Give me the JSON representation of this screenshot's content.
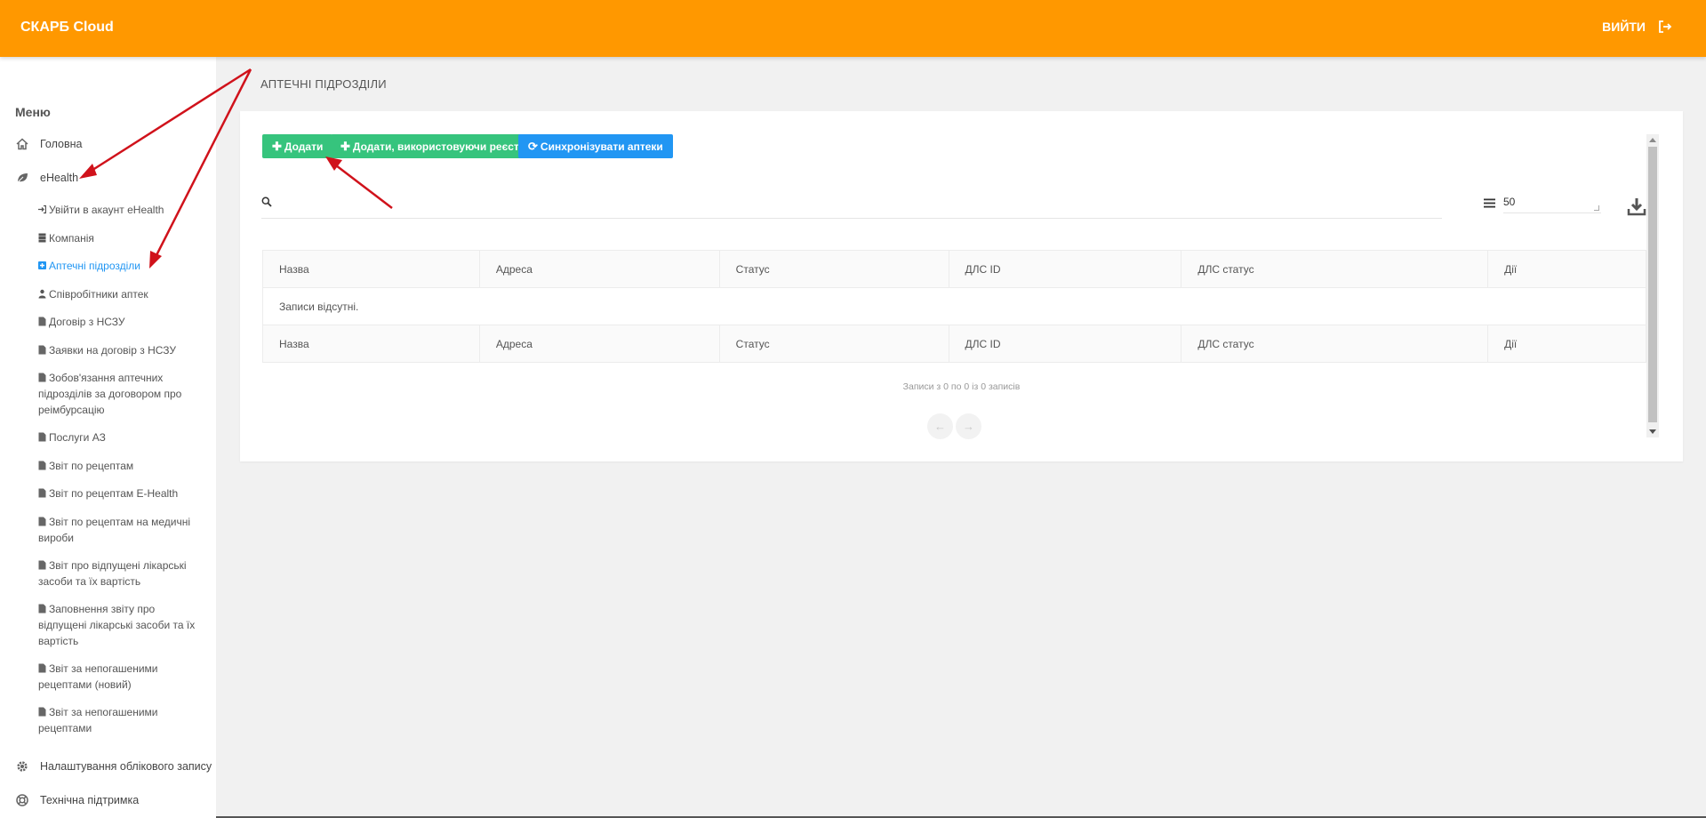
{
  "header": {
    "brand": "СКАРБ Cloud",
    "logout_label": "ВИЙТИ"
  },
  "sidebar": {
    "menu_title": "Меню",
    "home_label": "Головна",
    "ehealth_label": "eHealth",
    "items": [
      {
        "label": "Увійти в акаунт eHealth",
        "icon": "sign-in-icon"
      },
      {
        "label": "Компанія",
        "icon": "database-icon"
      },
      {
        "label": "Аптечні підрозділи",
        "icon": "plus-square-icon",
        "active": true
      },
      {
        "label": "Співробітники аптек",
        "icon": "users-icon"
      },
      {
        "label": "Договір з НСЗУ",
        "icon": "file-icon"
      },
      {
        "label": "Заявки на договір з НСЗУ",
        "icon": "file-icon"
      },
      {
        "label": "Зобов'язання аптечних підрозділів за договором про реімбурсацію",
        "icon": "file-icon"
      },
      {
        "label": "Послуги АЗ",
        "icon": "file-icon"
      },
      {
        "label": "Звіт по рецептам",
        "icon": "file-icon"
      },
      {
        "label": "Звіт по рецептам E-Health",
        "icon": "file-icon"
      },
      {
        "label": "Звіт по рецептам на медичні вироби",
        "icon": "file-icon"
      },
      {
        "label": "Звіт про відпущені лікарські засоби та їх вартість",
        "icon": "file-icon"
      },
      {
        "label": "Заповнення звіту про відпущені лікарські засоби та їх вартість",
        "icon": "file-icon"
      },
      {
        "label": "Звіт за непогашеними рецептами (новий)",
        "icon": "file-icon"
      },
      {
        "label": "Звіт за непогашеними рецептами",
        "icon": "file-icon"
      }
    ],
    "settings_label": "Налаштування облікового запису",
    "support_label": "Технічна підтримка"
  },
  "page": {
    "title": "АПТЕЧНІ ПІДРОЗДІЛИ"
  },
  "toolbar": {
    "add_label": "Додати",
    "add_registry_label": "Додати, використовуючи реєстр",
    "sync_label": "Синхронізувати аптеки"
  },
  "search": {
    "value": "",
    "placeholder": ""
  },
  "page_size": "50",
  "table": {
    "columns": [
      "Назва",
      "Адреса",
      "Статус",
      "ДЛС ID",
      "ДЛС статус",
      "Дії"
    ],
    "empty_text": "Записи відсутні."
  },
  "pagination": {
    "info": "Записи з 0 по 0 із 0 записів",
    "prev": "←",
    "next": "→"
  },
  "colors": {
    "header": "#ff9800",
    "green": "#36c47d",
    "blue": "#2196f3",
    "active_link": "#2196f3",
    "annotation": "#d0121b"
  }
}
